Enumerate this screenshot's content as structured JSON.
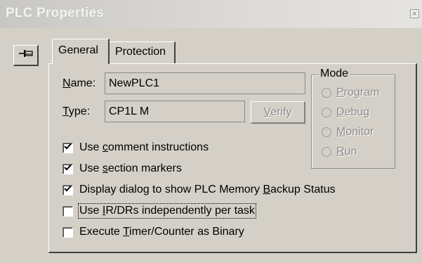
{
  "window": {
    "title": "PLC Properties",
    "close_glyph": "×"
  },
  "pin_icon": "pin-icon",
  "tabs": [
    {
      "label": "General",
      "selected": true
    },
    {
      "label": "Protection",
      "selected": false
    }
  ],
  "fields": {
    "name": {
      "label_pre": "",
      "label_u": "N",
      "label_post": "ame:",
      "value": "NewPLC1"
    },
    "type": {
      "label_pre": "",
      "label_u": "T",
      "label_post": "ype:",
      "value": "CP1L M"
    }
  },
  "verify_button": {
    "pre": "",
    "u": "V",
    "post": "erify",
    "enabled": false
  },
  "mode": {
    "legend": "Mode",
    "options": [
      {
        "pre": "",
        "u": "P",
        "post": "rogram"
      },
      {
        "pre": "",
        "u": "D",
        "post": "ebug"
      },
      {
        "pre": "",
        "u": "M",
        "post": "onitor"
      },
      {
        "pre": "",
        "u": "R",
        "post": "un"
      }
    ],
    "enabled": false
  },
  "options": [
    {
      "pre": "Use ",
      "u": "c",
      "post": "omment instructions",
      "checked": true
    },
    {
      "pre": "Use ",
      "u": "s",
      "post": "ection markers",
      "checked": true
    },
    {
      "pre": "Display dialog to show PLC Memory ",
      "u": "B",
      "post": "ackup Status",
      "checked": true
    },
    {
      "pre": "Use ",
      "u": "I",
      "post": "R/DRs independently per task",
      "checked": false,
      "focused": true
    },
    {
      "pre": "Execute ",
      "u": "T",
      "post": "imer/Counter as Binary",
      "checked": false
    }
  ],
  "colors": {
    "face": "#d4d0c8",
    "disabled_text": "#8c8c8c",
    "shadow": "#404040"
  }
}
